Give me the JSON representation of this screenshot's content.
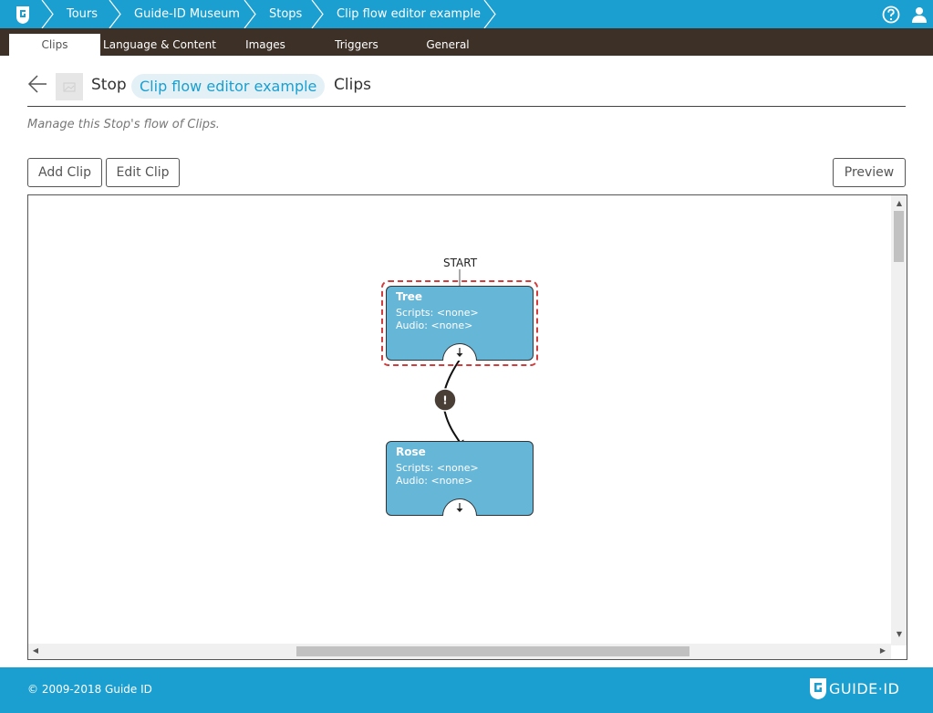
{
  "breadcrumb": {
    "items": [
      {
        "label": "Tours"
      },
      {
        "label": "Guide-ID Museum"
      },
      {
        "label": "Stops"
      },
      {
        "label": "Clip flow editor example"
      }
    ]
  },
  "tabs": [
    {
      "label": "Clips",
      "active": true
    },
    {
      "label": "Language & Content",
      "active": false
    },
    {
      "label": "Images",
      "active": false
    },
    {
      "label": "Triggers",
      "active": false
    },
    {
      "label": "General",
      "active": false
    }
  ],
  "header": {
    "prefix": "Stop",
    "name": "Clip flow editor example",
    "suffix": "Clips",
    "subtitle": "Manage this Stop's flow of Clips."
  },
  "toolbar": {
    "add_clip": "Add Clip",
    "edit_clip": "Edit Clip",
    "preview": "Preview"
  },
  "flow": {
    "start_label": "START",
    "connector_label": "!",
    "clips": [
      {
        "title": "Tree",
        "scripts": "Scripts: <none>",
        "audio": "Audio: <none>",
        "selected": true
      },
      {
        "title": "Rose",
        "scripts": "Scripts: <none>",
        "audio": "Audio: <none>",
        "selected": false
      }
    ]
  },
  "footer": {
    "copyright": "© 2009-2018 Guide ID",
    "brand": "GUIDE·ID"
  },
  "colors": {
    "topbar": "#1a9fd0",
    "tabbar": "#3d3027",
    "node": "#66b6d8",
    "selection": "#d23c3c",
    "connector": "#4a3f37"
  },
  "icons": [
    "guide-id-logo-icon",
    "chevron-right-icon",
    "help-icon",
    "user-icon",
    "back-arrow-icon",
    "image-placeholder-icon",
    "down-arrow-icon"
  ]
}
